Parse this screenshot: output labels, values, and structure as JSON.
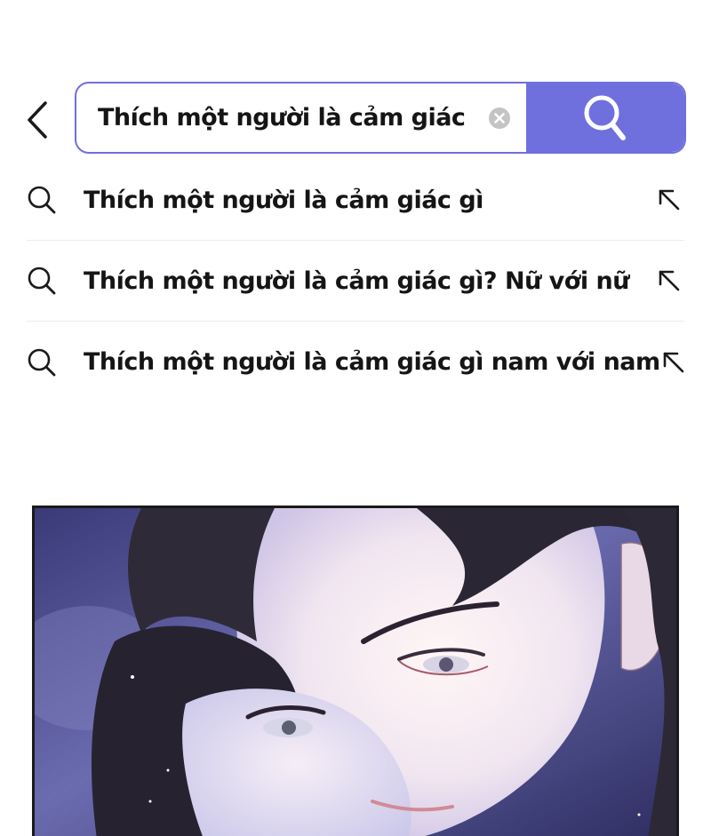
{
  "search": {
    "value": "Thích một người là cảm giác gì",
    "icons": {
      "back": "chevron-left-icon",
      "clear": "clear-circle-icon",
      "submit": "search-icon"
    },
    "accent_color": "#6f70de"
  },
  "suggestions": [
    {
      "text": "Thích một người là cảm giác gì"
    },
    {
      "text": "Thích một người là cảm giác gì? Nữ với nữ"
    },
    {
      "text": "Thích một người là cảm giác gì nam với nam"
    }
  ],
  "suggestion_icons": {
    "leading": "search-icon",
    "trailing": "fill-arrow-icon"
  },
  "illustration": {
    "subject": "manga-panel-two-characters"
  }
}
